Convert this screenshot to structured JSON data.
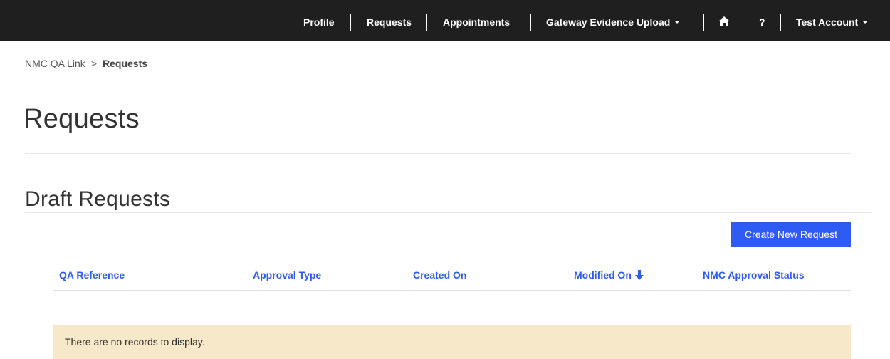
{
  "nav": {
    "profile": "Profile",
    "requests": "Requests",
    "appointments": "Appointments",
    "gateway": "Gateway Evidence Upload",
    "help": "?",
    "account": "Test Account"
  },
  "breadcrumb": {
    "root": "NMC QA Link",
    "separator": ">",
    "current": "Requests"
  },
  "page": {
    "title": "Requests",
    "section_title": "Draft Requests"
  },
  "actions": {
    "create_label": "Create New Request"
  },
  "table": {
    "columns": [
      "QA Reference",
      "Approval Type",
      "Created On",
      "Modified On",
      "NMC Approval Status"
    ],
    "sort_column": "Modified On",
    "sort_direction": "descending",
    "empty_message": "There are no records to display."
  },
  "icons": {
    "home": "home-icon",
    "sort": "arrow-down-icon"
  },
  "colors": {
    "nav_bg": "#1f1f1f",
    "accent": "#2e5bf4",
    "empty_bg": "#f7e8c9"
  }
}
